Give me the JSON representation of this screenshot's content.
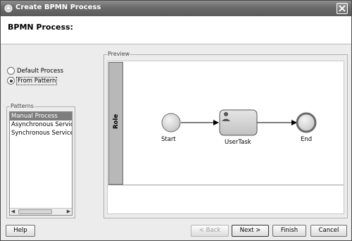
{
  "window": {
    "title": "Create BPMN Process"
  },
  "header": {
    "title": "BPMN Process:"
  },
  "options": {
    "default_process": "Default Process",
    "from_pattern": "From Pattern",
    "selected": "from_pattern"
  },
  "patterns": {
    "legend": "Patterns",
    "items": [
      "Manual Process",
      "Asynchronous Service",
      "Synchronous Service"
    ],
    "selected_index": 0
  },
  "preview": {
    "legend": "Preview",
    "lane_label": "Role",
    "start_label": "Start",
    "task_label": "UserTask",
    "end_label": "End"
  },
  "buttons": {
    "help": "Help",
    "back": "< Back",
    "next": "Next >",
    "finish": "Finish",
    "cancel": "Cancel"
  },
  "colors": {
    "titlebar": "#6a6a6a",
    "selection": "#7d7d7d",
    "node_fill": "#d9d9d9",
    "lane_header": "#b8b8b8"
  }
}
